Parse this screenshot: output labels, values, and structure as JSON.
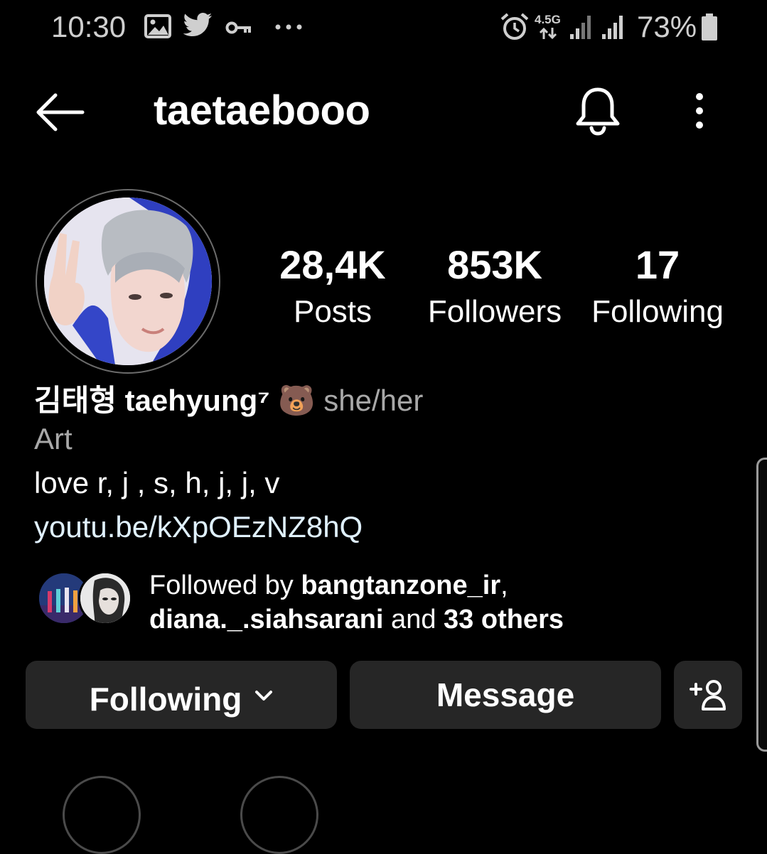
{
  "status_bar": {
    "time": "10:30",
    "network": "4.5G",
    "battery": "73%",
    "icons": [
      "gallery-icon",
      "twitter-icon",
      "key-icon",
      "more-dots-icon",
      "alarm-icon",
      "signal-icon",
      "battery-icon"
    ]
  },
  "header": {
    "username": "taetaebooo"
  },
  "stats": {
    "posts": {
      "value": "28,4K",
      "label": "Posts"
    },
    "followers": {
      "value": "853K",
      "label": "Followers"
    },
    "following": {
      "value": "17",
      "label": "Following"
    }
  },
  "bio": {
    "name": "김태형 taehyung⁷",
    "emoji": "🐻",
    "pronouns": "she/her",
    "category": "Art",
    "text": "love r, j , s, h, j, j, v",
    "link": "youtu.be/kXpOEzNZ8hQ"
  },
  "followed_by": {
    "prefix": "Followed by ",
    "user1": "bangtanzone_ir",
    "comma": ",",
    "user2": "diana._.siahsarani",
    "and": " and ",
    "others": "33 others"
  },
  "actions": {
    "following_label": "Following",
    "message_label": "Message"
  },
  "colors": {
    "background": "#000000",
    "button": "#262626",
    "secondary_text": "#a8a8a8",
    "link": "#e0f1ff"
  }
}
